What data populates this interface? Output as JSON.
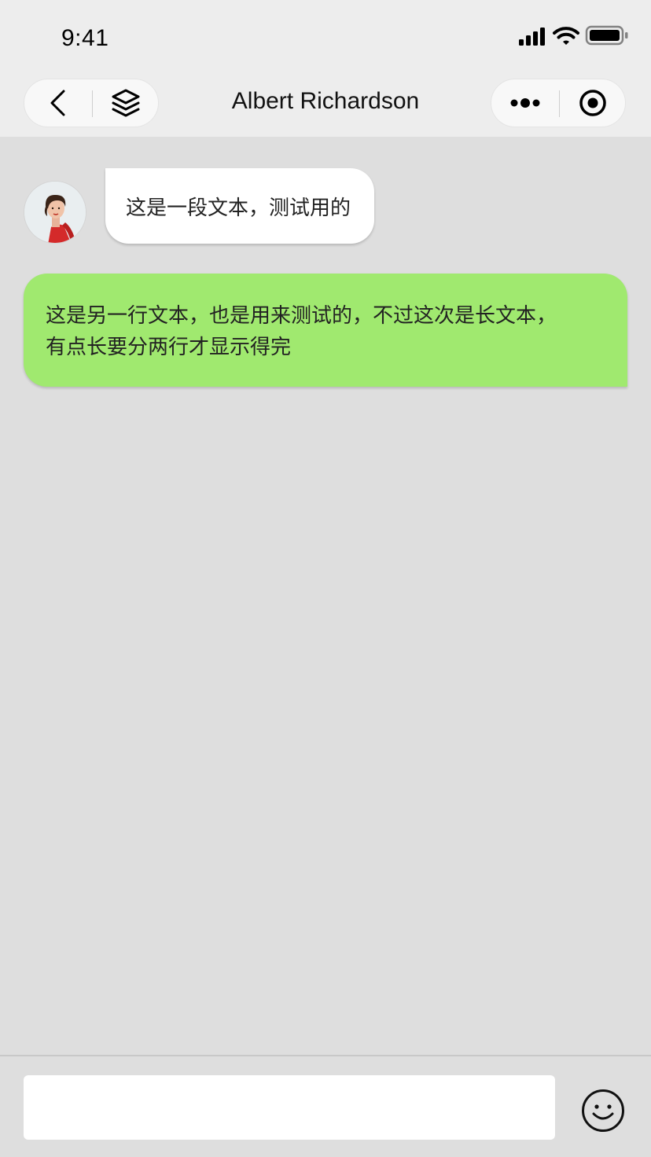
{
  "status_bar": {
    "time": "9:41"
  },
  "header": {
    "title": "Albert Richardson",
    "left_capsule": {
      "back_icon": "chevron-left-icon",
      "layers_icon": "layers-icon"
    },
    "right_capsule": {
      "more_icon": "more-dots-icon",
      "record_icon": "record-icon"
    }
  },
  "messages": [
    {
      "direction": "incoming",
      "avatar_icon": "user-avatar",
      "lines": [
        "这是一段文本，测试用的"
      ]
    },
    {
      "direction": "outgoing",
      "lines": [
        "这是另一行文本，也是用来测试的，不过这次是长文本，",
        "有点长要分两行才显示得完"
      ]
    }
  ],
  "input_bar": {
    "value": "",
    "placeholder": "",
    "emoji_icon": "smiley-icon"
  },
  "colors": {
    "background": "#dedede",
    "header_background": "#ededed",
    "incoming_bubble": "#ffffff",
    "outgoing_bubble": "#a0e96f"
  }
}
